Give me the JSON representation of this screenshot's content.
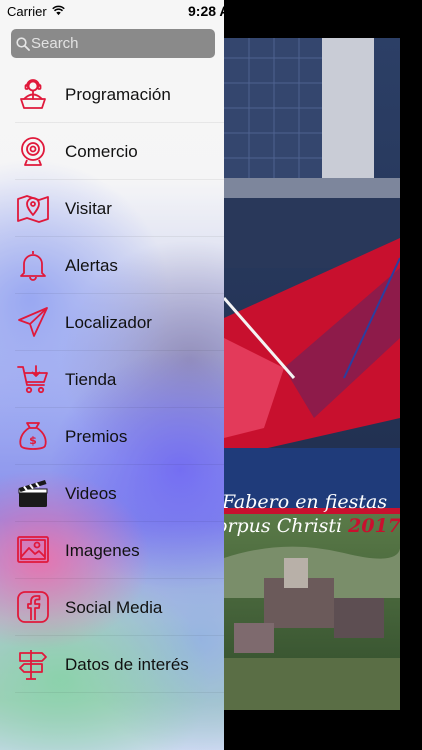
{
  "status_bar": {
    "carrier": "Carrier",
    "time": "9:28 A"
  },
  "search": {
    "placeholder": "Search"
  },
  "menu": {
    "items": [
      {
        "label": "Programación",
        "icon": "radio-host-icon"
      },
      {
        "label": "Comercio",
        "icon": "webcam-icon"
      },
      {
        "label": "Visitar",
        "icon": "map-pin-icon"
      },
      {
        "label": "Alertas",
        "icon": "bell-icon"
      },
      {
        "label": "Localizador",
        "icon": "paper-plane-icon"
      },
      {
        "label": "Tienda",
        "icon": "shopping-cart-icon"
      },
      {
        "label": "Premios",
        "icon": "money-bag-icon"
      },
      {
        "label": "Videos",
        "icon": "clapperboard-icon"
      },
      {
        "label": "Imagenes",
        "icon": "image-icon"
      },
      {
        "label": "Social Media",
        "icon": "facebook-icon"
      },
      {
        "label": "Datos de interés",
        "icon": "signpost-icon"
      }
    ]
  },
  "poster": {
    "line1": "Fabero en fiestas",
    "line2": "orpus Christi ",
    "year": "2017"
  },
  "colors": {
    "icon_accent": "#e0193b",
    "search_bg": "#8a8a8a",
    "poster_red": "#c8102e"
  }
}
